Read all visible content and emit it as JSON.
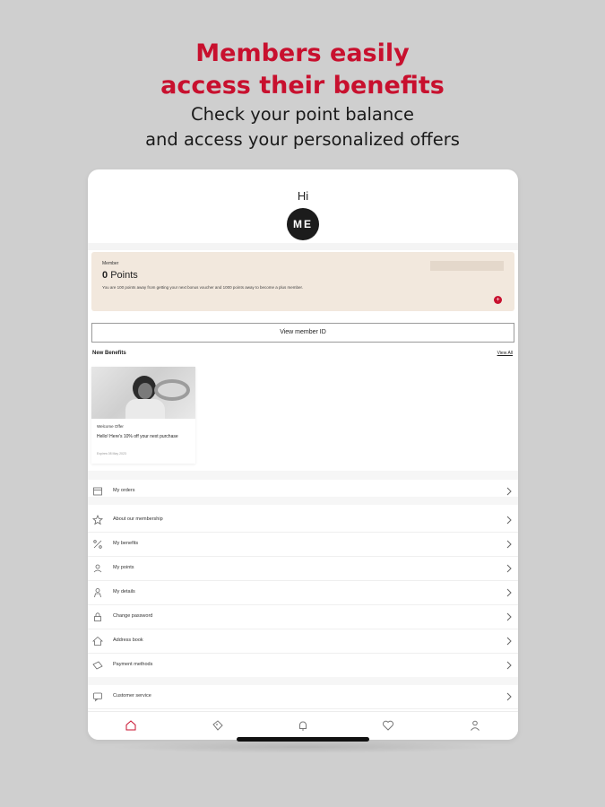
{
  "promo": {
    "headline_line1": "Members easily",
    "headline_line2": "access their benefits",
    "sub_line1": "Check your point balance",
    "sub_line2": "and access your personalized offers",
    "accent_color": "#c8102e"
  },
  "profile": {
    "greeting": "Hi",
    "avatar_initials": "ME"
  },
  "member_card": {
    "label": "Member",
    "points_value": "0",
    "points_unit": "Points",
    "description": "You are 100 points away from getting your next bonus voucher and 1000 points away to become a plus member.",
    "card_color": "#f2e8dd"
  },
  "view_member_id": "View member ID",
  "benefits": {
    "title": "New Benefits",
    "view_all": "View All",
    "card": {
      "tag": "Welcome Offer",
      "text": "Hello! Here's 10% off your next purchase",
      "expiry": "Expires 08 May 2023"
    }
  },
  "menu": [
    {
      "label": "My orders",
      "icon": "orders-icon"
    },
    {
      "label": "About our membership",
      "icon": "star-icon"
    },
    {
      "label": "My benefits",
      "icon": "percent-icon"
    },
    {
      "label": "My points",
      "icon": "points-icon"
    },
    {
      "label": "My details",
      "icon": "person-icon"
    },
    {
      "label": "Change password",
      "icon": "lock-icon"
    },
    {
      "label": "Address book",
      "icon": "home-icon"
    },
    {
      "label": "Payment methods",
      "icon": "card-icon"
    },
    {
      "label": "Customer service",
      "icon": "chat-icon"
    }
  ],
  "tabbar": [
    "home-icon",
    "tag-icon",
    "bell-icon",
    "heart-icon",
    "account-icon"
  ]
}
